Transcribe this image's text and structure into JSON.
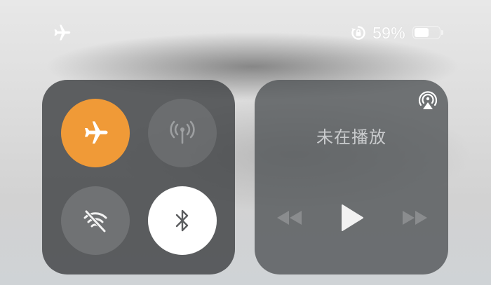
{
  "status_bar": {
    "airplane_icon": "airplane-icon",
    "orientation_lock_icon": "orientation-lock-icon",
    "battery_percent": "59%",
    "battery_level": 0.59
  },
  "connectivity": {
    "airplane_mode": {
      "icon": "airplane-icon",
      "on": true,
      "color": "#f09a37"
    },
    "cellular_data": {
      "icon": "cellular-antenna-icon",
      "on": false
    },
    "wifi": {
      "icon": "wifi-off-icon",
      "on": false
    },
    "bluetooth": {
      "icon": "bluetooth-icon",
      "on": true
    }
  },
  "music": {
    "airplay_icon": "airplay-icon",
    "status": "未在播放",
    "controls": [
      "rewind-icon",
      "play-icon",
      "fast-forward-icon"
    ]
  }
}
